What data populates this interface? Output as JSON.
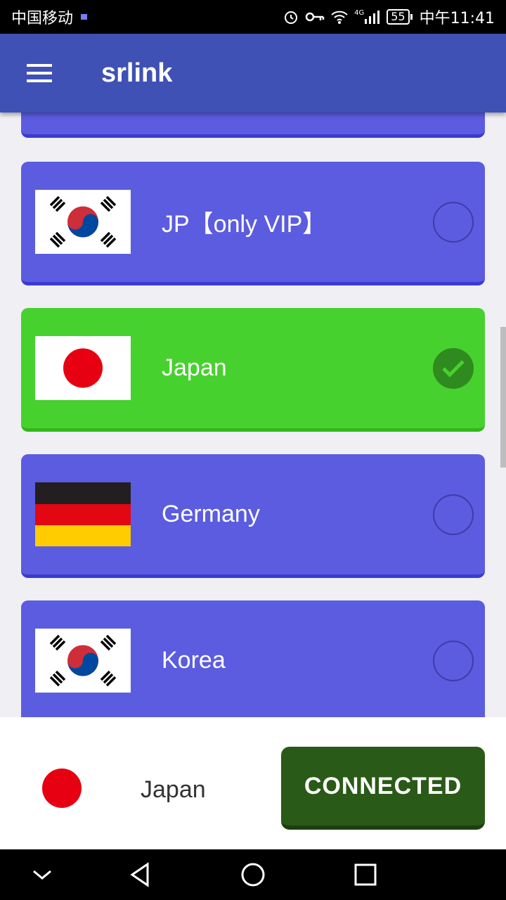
{
  "status_bar": {
    "carrier": "中国移动",
    "battery": "55",
    "time": "中午11:41",
    "network": "4G"
  },
  "app_bar": {
    "title": "srlink",
    "menu_icon": "hamburger-menu-icon"
  },
  "servers": [
    {
      "label": "JP【only VIP】",
      "flag": "korea",
      "selected": false
    },
    {
      "label": "Japan",
      "flag": "japan",
      "selected": true
    },
    {
      "label": "Germany",
      "flag": "germany",
      "selected": false
    },
    {
      "label": "Korea",
      "flag": "korea",
      "selected": false
    }
  ],
  "current": {
    "label": "Japan",
    "flag": "japan"
  },
  "connect_button": {
    "label": "CONNECTED"
  },
  "colors": {
    "app_bar": "#3f51b5",
    "card_blue": "#5c5ce0",
    "card_selected": "#47d12e",
    "button": "#2a5a17"
  }
}
